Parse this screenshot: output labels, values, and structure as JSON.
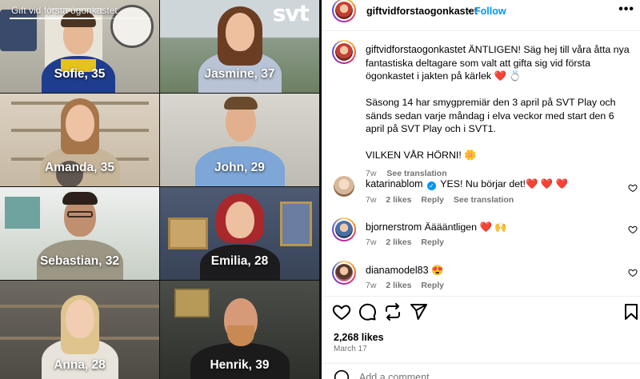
{
  "media": {
    "show_title": "Gift vid första ögonkastet",
    "logo": "svt",
    "progress": 0.65,
    "contestants": [
      {
        "name": "Sofie, 35"
      },
      {
        "name": "Jasmine, 37"
      },
      {
        "name": "Amanda, 35"
      },
      {
        "name": "John, 29"
      },
      {
        "name": "Sebastian, 32"
      },
      {
        "name": "Emilia, 28"
      },
      {
        "name": "Anna, 28"
      },
      {
        "name": "Henrik, 39"
      }
    ]
  },
  "post": {
    "author": "giftvidforstaogonkastet",
    "follow_label": "Follow",
    "separator": "•",
    "caption_p1": "ÄNTLIGEN! Säg hej till våra åtta nya fantastiska deltagare som valt att gifta sig vid första ögonkastet i jakten på kärlek ❤️ 💍",
    "caption_p2": "Säsong 14 har smygpremiär den 3 april på SVT Play och sänds sedan varje måndag i elva veckor med start den 6 april på SVT Play och i SVT1.",
    "caption_p3": "VILKEN VÅR HÖRNI! 🌼",
    "caption_age": "7w",
    "see_translation": "See translation"
  },
  "comments": [
    {
      "user": "katarinablom",
      "verified": true,
      "text": "YES! Nu börjar det!❤️ ❤️ ❤️",
      "age": "7w",
      "likes": "2 likes",
      "reply": "Reply",
      "translate": "See translation"
    },
    {
      "user": "bjornerstrom",
      "verified": false,
      "text": "Ääääntligen ❤️ 🙌",
      "age": "7w",
      "likes": "2 likes",
      "reply": "Reply"
    },
    {
      "user": "dianamodel83",
      "verified": false,
      "text": "😍",
      "age": "7w",
      "likes": "2 likes",
      "reply": "Reply"
    }
  ],
  "footer": {
    "likes": "2,268 likes",
    "date": "March 17",
    "add_comment_placeholder": "Add a comment..."
  },
  "icons": {
    "like": "heart-icon",
    "comment": "comment-bubble-icon",
    "share": "repost-icon",
    "send": "paper-plane-icon",
    "save": "bookmark-icon",
    "more": "more-horizontal-icon"
  },
  "colors": {
    "link": "#0095f6",
    "muted": "#737373",
    "divider": "#efefef"
  }
}
